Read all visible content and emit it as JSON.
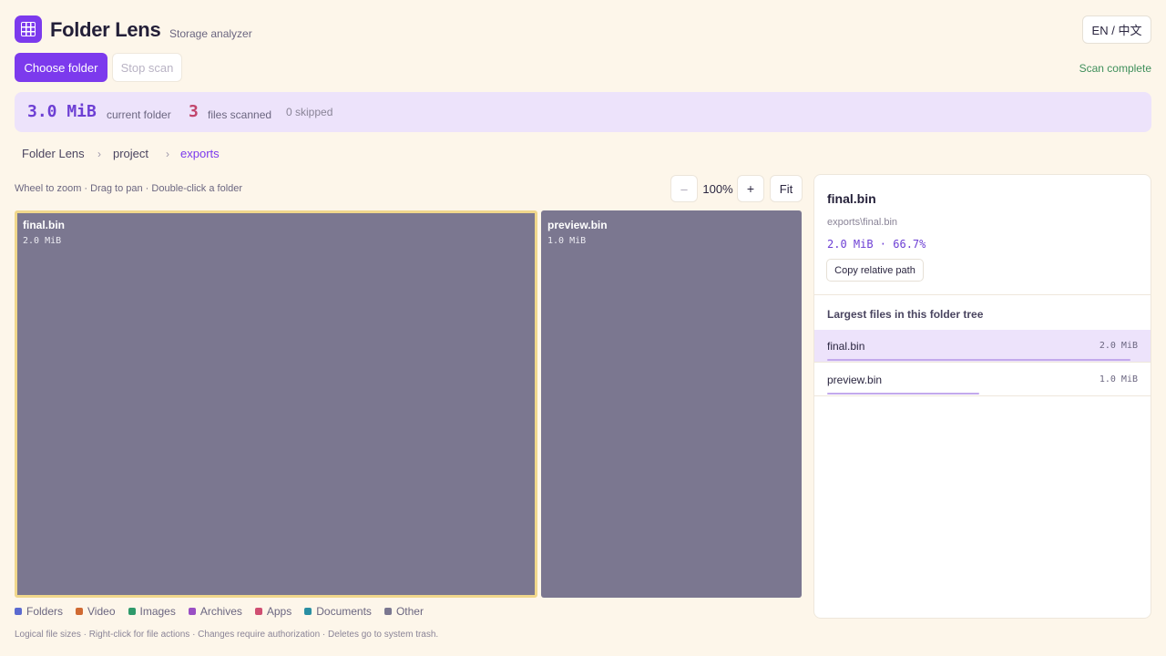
{
  "header": {
    "title": "Folder Lens",
    "subtitle": "Storage analyzer",
    "language_toggle": "EN / 中文",
    "logo_icon": "grid-icon"
  },
  "toolbar": {
    "choose_label": "Choose folder",
    "stop_label": "Stop scan",
    "status": "Scan complete"
  },
  "summary": {
    "size": "3.0 MiB",
    "size_label": "current folder",
    "files_count": "3",
    "files_label": "files scanned",
    "skipped": "0 skipped"
  },
  "breadcrumb": {
    "items": [
      "Folder Lens",
      "project",
      "exports"
    ],
    "separator": "›"
  },
  "view": {
    "hint": "Wheel to zoom · Drag to pan · Double-click a folder",
    "zoom_out": "–",
    "zoom_level": "100%",
    "zoom_in": "+",
    "fit": "Fit"
  },
  "treemap": {
    "tiles": [
      {
        "name": "final.bin",
        "size": "2.0 MiB",
        "share": 0.667,
        "selected": true
      },
      {
        "name": "preview.bin",
        "size": "1.0 MiB",
        "share": 0.333,
        "selected": false
      }
    ],
    "tile_color": "#7b7790",
    "selection_color": "#f0d78c"
  },
  "legend": [
    {
      "label": "Folders",
      "color": "#5b6ad0"
    },
    {
      "label": "Video",
      "color": "#d06a32"
    },
    {
      "label": "Images",
      "color": "#2f9a6b"
    },
    {
      "label": "Archives",
      "color": "#9a4fc4"
    },
    {
      "label": "Apps",
      "color": "#d04f72"
    },
    {
      "label": "Documents",
      "color": "#2a8fa3"
    },
    {
      "label": "Other",
      "color": "#7b7790"
    }
  ],
  "footer": "Logical file sizes · Right-click for file actions · Changes require authorization · Deletes go to system trash.",
  "details": {
    "name": "final.bin",
    "path": "exports\\final.bin",
    "meta": "2.0 MiB · 66.7%",
    "copy_label": "Copy relative path",
    "largest_title": "Largest files in this folder tree",
    "largest": [
      {
        "name": "final.bin",
        "size": "2.0 MiB",
        "fraction": 1.0,
        "active": true
      },
      {
        "name": "preview.bin",
        "size": "1.0 MiB",
        "fraction": 0.5,
        "active": false
      }
    ]
  },
  "colors": {
    "accent": "#7c3aed",
    "background": "#fdf6ea",
    "summary_bg": "#ede3fb",
    "status_ok": "#3f8f5b"
  }
}
